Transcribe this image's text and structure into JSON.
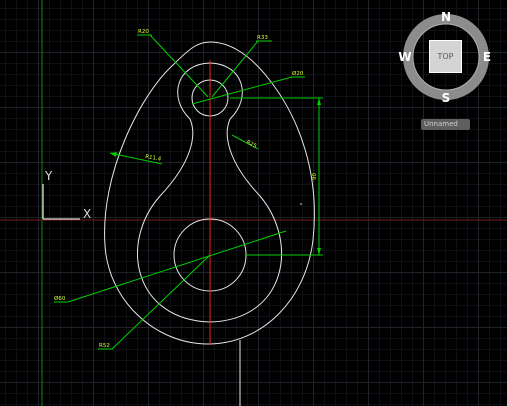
{
  "viewcube": {
    "north": "N",
    "south": "S",
    "east": "E",
    "west": "W",
    "face": "TOP",
    "wcs_menu": "Unnamed"
  },
  "ucs": {
    "x_label": "X",
    "y_label": "Y"
  },
  "dimensions": {
    "r20": "R20",
    "r33": "R33",
    "dia20": "Ø20",
    "r25": "R25",
    "r114": "R11.4",
    "len90": "90",
    "dia60": "Ø60",
    "r52": "R52"
  },
  "colors": {
    "geometry": "#e6e6e6",
    "dimension": "#00d000",
    "dimension_text": "#d6ff3a",
    "centerline": "#ff2020",
    "y_axis_line": "#1b7a1b",
    "x_axis_line": "#7a1b1b"
  }
}
